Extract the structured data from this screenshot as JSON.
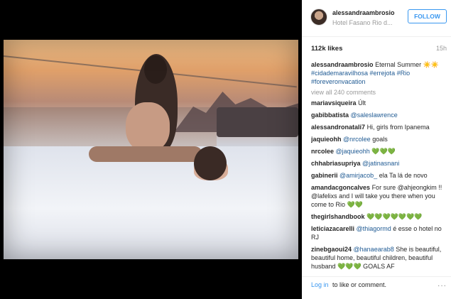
{
  "post": {
    "username": "alessandraambrosio",
    "location": "Hotel Fasano Rio d...",
    "follow_label": "FOLLOW",
    "likes": "112k likes",
    "time_ago": "15h",
    "caption_user": "alessandraambrosio",
    "caption_text": "Eternal Summer ☀️☀️",
    "caption_hashtags": "#cidademaravilhosa #errejota #Rio #foreveronvacation",
    "view_all": "view all 240 comments"
  },
  "comments": [
    {
      "user": "mariavsiqueira",
      "mention": "",
      "text": "Últ"
    },
    {
      "user": "gabibbatista",
      "mention": "@saleslawrence",
      "text": ""
    },
    {
      "user": "alessandronatali7",
      "mention": "",
      "text": "Hi, girls from Ipanema"
    },
    {
      "user": "jaquieohh",
      "mention": "@nrcolee",
      "text": "goals"
    },
    {
      "user": "nrcolee",
      "mention": "@jaquieohh",
      "text": "💚💚💚"
    },
    {
      "user": "chhabriasupriya",
      "mention": "@jatinasnani",
      "text": ""
    },
    {
      "user": "gabinerii",
      "mention": "@amirjacob_",
      "text": "ela Ta lá de novo"
    },
    {
      "user": "amandacgoncalves",
      "mention": "",
      "text": "For sure @ahjeongkim !! @lafelixs and I will take you there when you come to Rio 💚💚"
    },
    {
      "user": "thegirlshandbook",
      "mention": "",
      "text": "💚💚💚💚💚💚💚"
    },
    {
      "user": "leticiazacarelli",
      "mention": "@thiagormd",
      "text": "é esse o hotel no RJ"
    },
    {
      "user": "zinebgaoui24",
      "mention": "@hanaearab8",
      "text": "She is beautiful, beautiful home, beautiful children, beautiful husband 💚💚💚 GOALS AF"
    }
  ],
  "footer": {
    "login_link": "Log in",
    "login_rest": "to like or comment.",
    "more_icon": "..."
  },
  "icons": {
    "more": "more-options-icon"
  },
  "colors": {
    "link_blue": "#3897f0",
    "hashtag_blue": "#1f5a93"
  }
}
